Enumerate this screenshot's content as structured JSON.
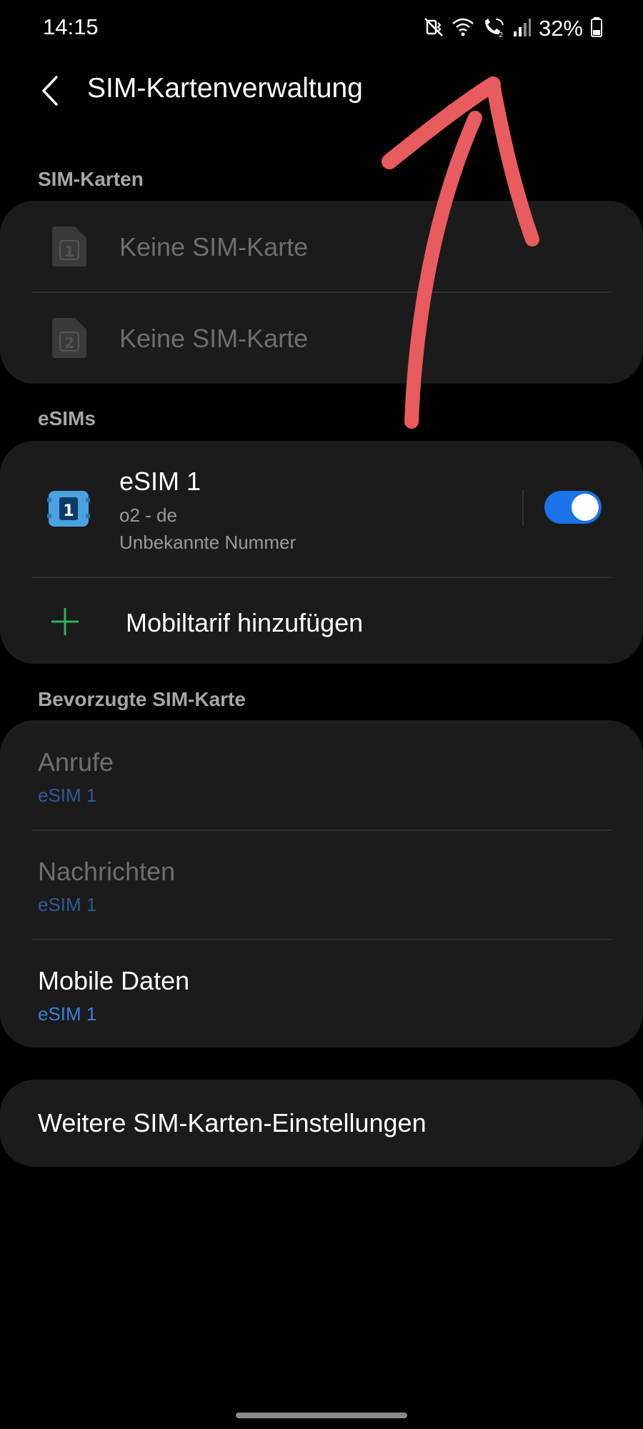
{
  "status_bar": {
    "time": "14:15",
    "battery_percent": "32%",
    "icons": [
      "mute-vibrate-icon",
      "wifi-icon",
      "wifi-calling-icon",
      "signal-icon",
      "battery-icon"
    ]
  },
  "app_bar": {
    "title": "SIM-Kartenverwaltung",
    "back_icon": "chevron-left-icon"
  },
  "sections": {
    "sim_cards": {
      "header": "SIM-Karten",
      "items": [
        {
          "slot": "1",
          "label": "Keine SIM-Karte"
        },
        {
          "slot": "2",
          "label": "Keine SIM-Karte"
        }
      ]
    },
    "esims": {
      "header": "eSIMs",
      "esim": {
        "slot": "1",
        "name": "eSIM 1",
        "carrier": "o2 - de",
        "number": "Unbekannte Nummer",
        "enabled": true
      },
      "add_plan_label": "Mobiltarif hinzufügen"
    },
    "preferred": {
      "header": "Bevorzugte SIM-Karte",
      "items": [
        {
          "label": "Anrufe",
          "value": "eSIM 1"
        },
        {
          "label": "Nachrichten",
          "value": "eSIM 1"
        },
        {
          "label": "Mobile Daten",
          "value": "eSIM 1"
        }
      ]
    },
    "more": {
      "label": "Weitere SIM-Karten-Einstellungen"
    }
  },
  "colors": {
    "background": "#000000",
    "card": "#1b1b1b",
    "accent_blue": "#1a73e8",
    "plus_green": "#2fb35b",
    "annotation_red": "#e85b5e"
  }
}
